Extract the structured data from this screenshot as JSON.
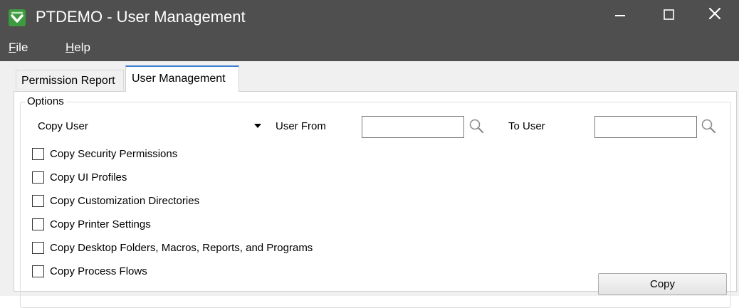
{
  "window": {
    "title": "PTDEMO - User Management",
    "icon": "sage-app-icon",
    "controls": [
      "minimize-icon",
      "maximize-icon",
      "close-icon"
    ],
    "titlebar_color": "#4f4f4f"
  },
  "menu": {
    "items": [
      {
        "mnemonic": "F",
        "rest": "ile"
      },
      {
        "mnemonic": "H",
        "rest": "elp"
      }
    ]
  },
  "tabs": [
    {
      "label": "Permission Report",
      "selected": false
    },
    {
      "label": "User Management",
      "selected": true
    }
  ],
  "options": {
    "group_label": "Options",
    "action_select": {
      "value": "Copy User"
    },
    "user_from": {
      "label": "User From",
      "value": ""
    },
    "to_user": {
      "label": "To User",
      "value": ""
    },
    "checkboxes": [
      {
        "label": "Copy Security Permissions",
        "checked": false
      },
      {
        "label": "Copy UI Profiles",
        "checked": false
      },
      {
        "label": "Copy Customization Directories",
        "checked": false
      },
      {
        "label": "Copy Printer Settings",
        "checked": false
      },
      {
        "label": "Copy Desktop Folders, Macros, Reports, and Programs",
        "checked": false
      },
      {
        "label": "Copy Process Flows",
        "checked": false
      }
    ],
    "copy_button": {
      "label": "Copy"
    }
  }
}
